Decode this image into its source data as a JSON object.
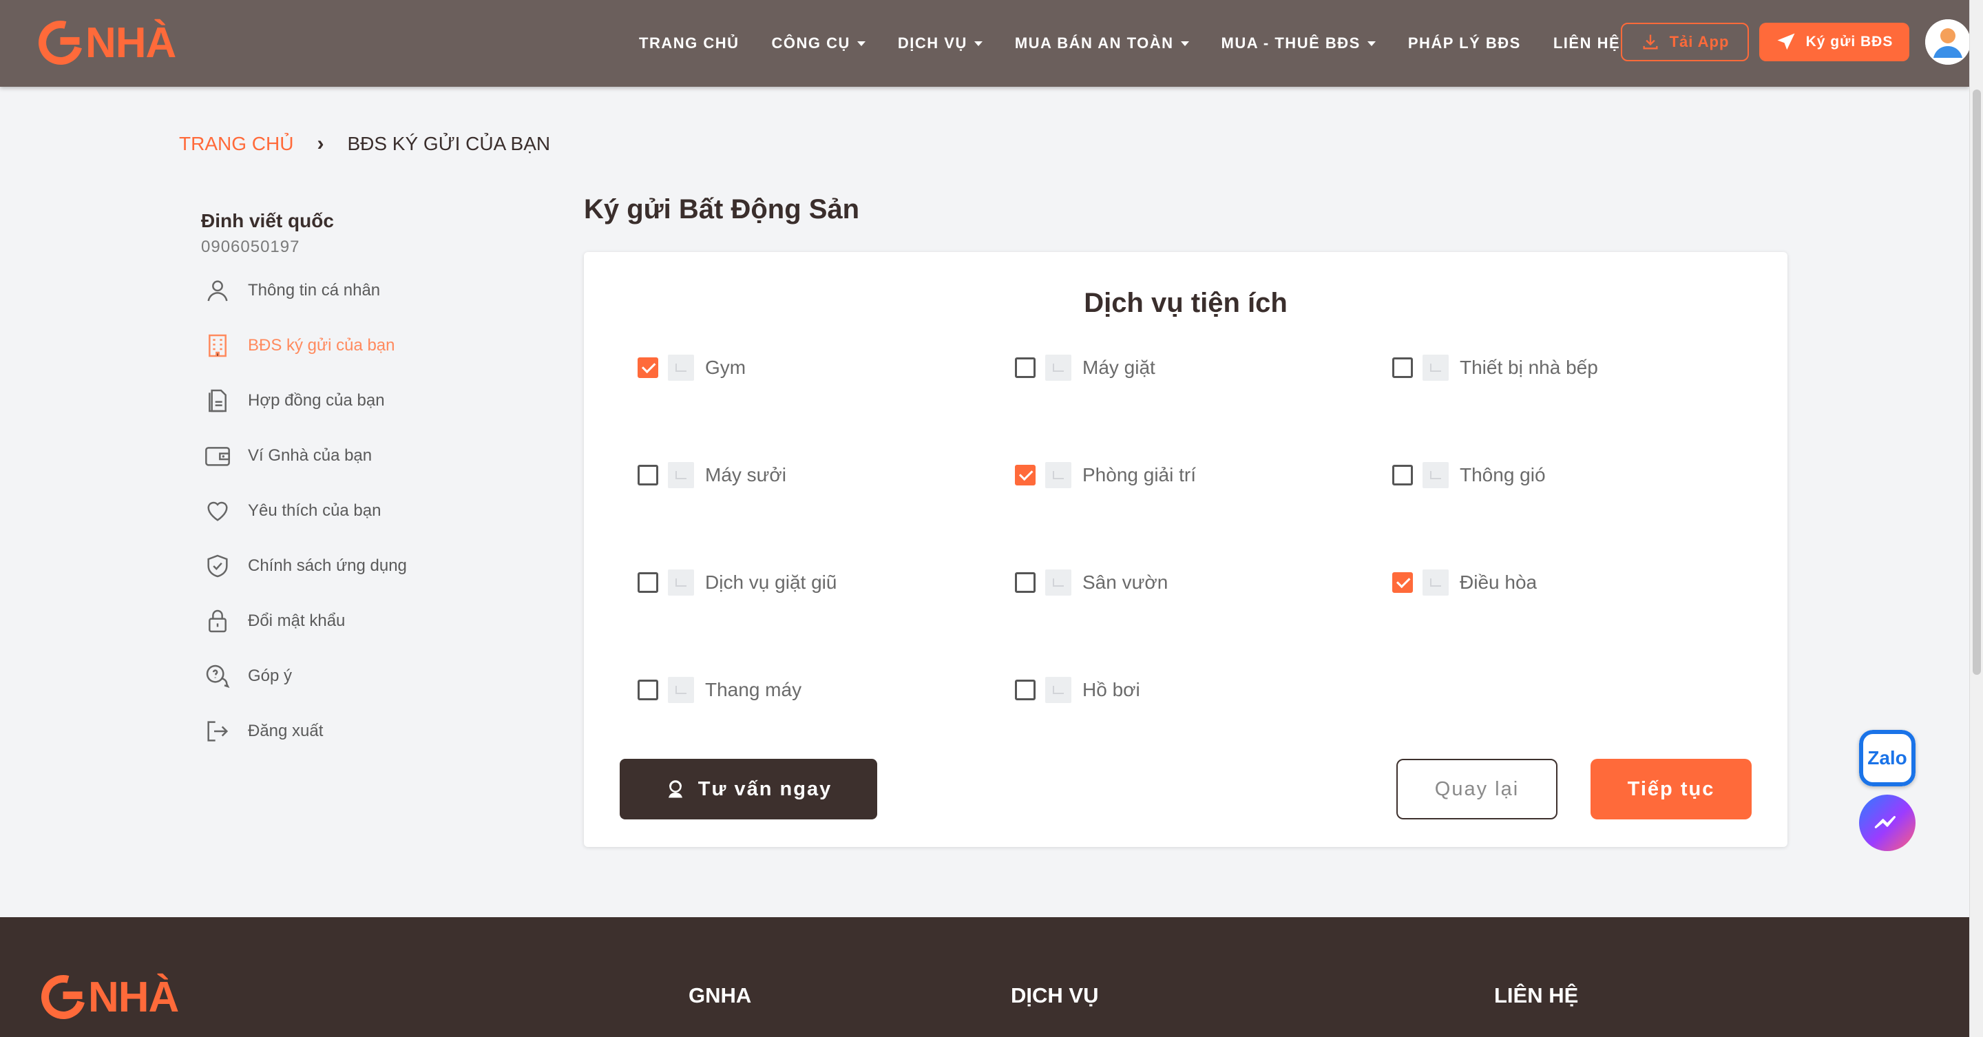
{
  "header": {
    "logo_text": "NHÀ",
    "nav": [
      {
        "label": "TRANG CHỦ",
        "dropdown": false
      },
      {
        "label": "CÔNG CỤ",
        "dropdown": true
      },
      {
        "label": "DỊCH VỤ",
        "dropdown": true
      },
      {
        "label": "MUA BÁN AN TOÀN",
        "dropdown": true
      },
      {
        "label": "MUA - THUÊ BĐS",
        "dropdown": true
      },
      {
        "label": "PHÁP LÝ BĐS",
        "dropdown": false
      },
      {
        "label": "LIÊN HỆ",
        "dropdown": false
      }
    ],
    "download_app_label": "Tải App",
    "consign_label": "Ký gửi BĐS"
  },
  "breadcrumb": {
    "home": "TRANG CHỦ",
    "current": "BĐS KÝ GỬI CỦA BẠN"
  },
  "user": {
    "name": "Đinh viết quốc",
    "phone": "0906050197"
  },
  "sidebar": {
    "items": [
      {
        "label": "Thông tin cá nhân",
        "icon": "user-icon",
        "active": false
      },
      {
        "label": "BĐS ký gửi của bạn",
        "icon": "building-icon",
        "active": true
      },
      {
        "label": "Hợp đồng của bạn",
        "icon": "contract-icon",
        "active": false
      },
      {
        "label": "Ví Gnhà của bạn",
        "icon": "wallet-icon",
        "active": false
      },
      {
        "label": "Yêu thích của bạn",
        "icon": "heart-icon",
        "active": false
      },
      {
        "label": "Chính sách ứng dụng",
        "icon": "shield-icon",
        "active": false
      },
      {
        "label": "Đổi mật khẩu",
        "icon": "lock-icon",
        "active": false
      },
      {
        "label": "Góp ý",
        "icon": "feedback-icon",
        "active": false
      },
      {
        "label": "Đăng xuất",
        "icon": "logout-icon",
        "active": false
      }
    ]
  },
  "main": {
    "title": "Ký gửi Bất Động Sản",
    "card_title": "Dịch vụ tiện ích",
    "amenities": [
      {
        "label": "Gym",
        "checked": true
      },
      {
        "label": "Máy giặt",
        "checked": false
      },
      {
        "label": "Thiết bị nhà bếp",
        "checked": false
      },
      {
        "label": "Máy sưởi",
        "checked": false
      },
      {
        "label": "Phòng giải trí",
        "checked": true
      },
      {
        "label": "Thông gió",
        "checked": false
      },
      {
        "label": "Dịch vụ giặt giũ",
        "checked": false
      },
      {
        "label": "Sân vườn",
        "checked": false
      },
      {
        "label": "Điều hòa",
        "checked": true
      },
      {
        "label": "Thang máy",
        "checked": false
      },
      {
        "label": "Hồ bơi",
        "checked": false
      }
    ],
    "consult_label": "Tư vấn ngay",
    "back_label": "Quay lại",
    "next_label": "Tiếp tục"
  },
  "floating": {
    "zalo_label": "Zalo"
  },
  "footer": {
    "columns": [
      "GNHA",
      "DỊCH VỤ",
      "LIÊN HỆ"
    ]
  },
  "colors": {
    "accent": "#ff6a3a",
    "header_bg": "#6b5f5c",
    "dark": "#3d302d"
  }
}
